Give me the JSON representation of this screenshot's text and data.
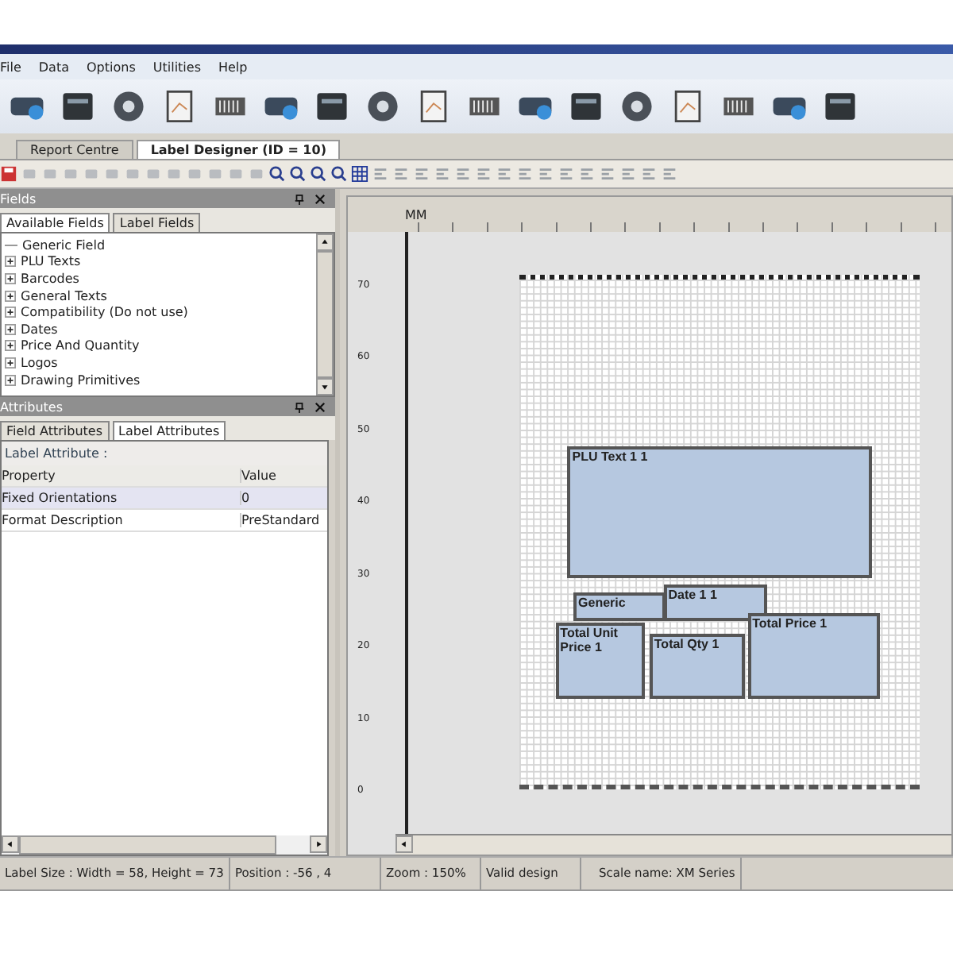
{
  "menu": [
    "File",
    "Data",
    "Options",
    "Utilities",
    "Help"
  ],
  "doc_tabs": [
    {
      "label": "Report Centre",
      "selected": false
    },
    {
      "label": "Label Designer (ID = 10)",
      "selected": true
    }
  ],
  "fields_panel": {
    "title": "Fields",
    "tabs": [
      {
        "label": "Available Fields",
        "selected": true
      },
      {
        "label": "Label Fields",
        "selected": false
      }
    ],
    "tree": [
      {
        "label": "Generic Field",
        "kind": "leaf"
      },
      {
        "label": "PLU Texts",
        "kind": "group"
      },
      {
        "label": "Barcodes",
        "kind": "group"
      },
      {
        "label": "General Texts",
        "kind": "group"
      },
      {
        "label": "Compatibility (Do not use)",
        "kind": "group"
      },
      {
        "label": "Dates",
        "kind": "group"
      },
      {
        "label": "Price And Quantity",
        "kind": "group"
      },
      {
        "label": "Logos",
        "kind": "group"
      },
      {
        "label": "Drawing Primitives",
        "kind": "group"
      }
    ]
  },
  "attributes_panel": {
    "title": "Attributes",
    "tabs": [
      {
        "label": "Field Attributes",
        "selected": false
      },
      {
        "label": "Label Attributes",
        "selected": true
      }
    ],
    "heading": "Label Attribute :",
    "columns": [
      "Property",
      "Value"
    ],
    "rows": [
      {
        "cells": [
          "Fixed Orientations",
          "0"
        ],
        "selected": true
      },
      {
        "cells": [
          "Format Description",
          "PreStandard"
        ],
        "selected": false
      }
    ]
  },
  "designer": {
    "unit": "MM",
    "vertical_ruler": [
      "70",
      "60",
      "50",
      "40",
      "30",
      "20",
      "10",
      "0"
    ],
    "fields": [
      {
        "label": "PLU Text 1 1"
      },
      {
        "label": "Generic"
      },
      {
        "label": "Date 1 1"
      },
      {
        "label": "Total Price 1"
      },
      {
        "label": "Total Unit Price 1"
      },
      {
        "label": "Total Qty 1"
      }
    ]
  },
  "status_bar": [
    "Label Size : Width = 58, Height = 73",
    "Position : -56 , 4",
    "Zoom : 150%",
    "Valid design",
    "Scale name: XM Series"
  ]
}
